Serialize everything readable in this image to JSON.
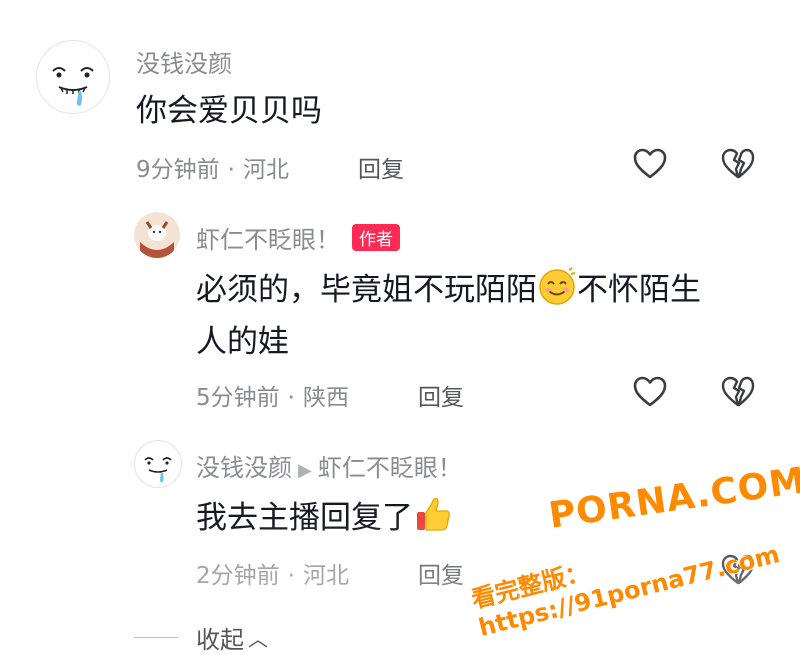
{
  "comments": [
    {
      "username": "没钱没颜",
      "text": "你会爱贝贝吗",
      "time": "9分钟前",
      "location": "河北",
      "reply_label": "回复"
    },
    {
      "username": "虾仁不眨眼！",
      "badge": "作者",
      "text_line1": "必须的，毕竟姐不玩陌陌",
      "text_line1_end": "不怀陌生",
      "text_line2": "人的娃",
      "time": "5分钟前",
      "location": "陕西",
      "reply_label": "回复"
    },
    {
      "username": "没钱没颜",
      "reply_to": "虾仁不眨眼！",
      "text": "我去主播回复了",
      "time": "2分钟前",
      "location": "河北",
      "reply_label": "回复"
    }
  ],
  "collapse_label": "收起",
  "watermark": {
    "line1": "PORNA.COM",
    "line2": "看完整版：https://91porna77.com"
  },
  "icons": {
    "like": "heart-outline-icon",
    "dislike": "broken-heart-icon",
    "emoji_smile": "smiling-face-emoji",
    "emoji_thumb": "thumbs-up-emoji"
  },
  "colors": {
    "author_badge": "#fe2c55",
    "meta_text": "#8a8b91",
    "watermark": "#ff8a00"
  }
}
